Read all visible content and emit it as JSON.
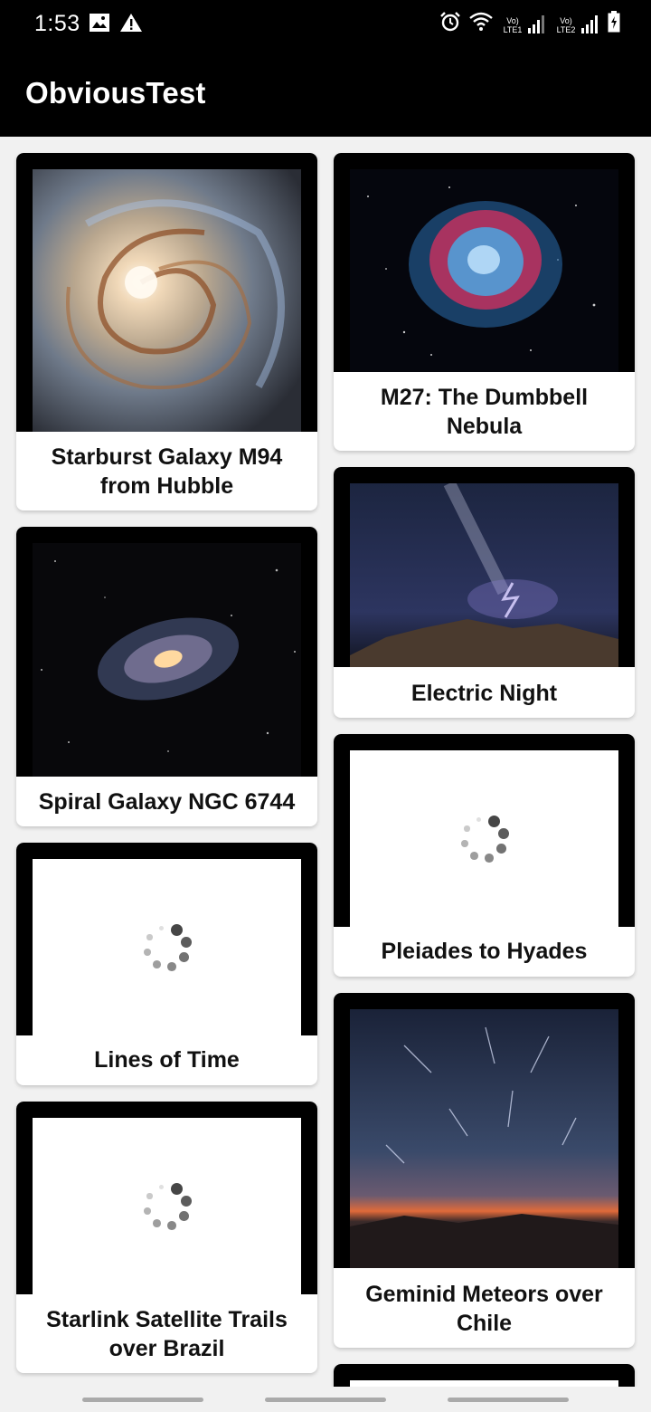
{
  "status_bar": {
    "time": "1:53",
    "left_icons": [
      "image-icon",
      "warning-icon"
    ],
    "right_icons": [
      "alarm-icon",
      "wifi-icon",
      "signal-lte1-icon",
      "signal-lte2-icon",
      "battery-charging-icon"
    ],
    "sim1_label": "Vo) LTE1",
    "sim2_label": "Vo) LTE2"
  },
  "app_bar": {
    "title": "ObviousTest"
  },
  "cards": [
    {
      "title": "Starburst Galaxy M94 from Hubble",
      "image": "galaxy-m94",
      "loading": false
    },
    {
      "title": "M27: The Dumbbell Nebula",
      "image": "dumbbell-nebula",
      "loading": false
    },
    {
      "title": "Spiral Galaxy NGC 6744",
      "image": "spiral-galaxy-ngc6744",
      "loading": false
    },
    {
      "title": "Electric Night",
      "image": "electric-night",
      "loading": false
    },
    {
      "title": "Lines of Time",
      "image": "loading-spinner",
      "loading": true
    },
    {
      "title": "Pleiades to Hyades",
      "image": "loading-spinner",
      "loading": true
    },
    {
      "title": "Starlink Satellite Trails over Brazil",
      "image": "loading-spinner",
      "loading": true
    },
    {
      "title": "Geminid Meteors over Chile",
      "image": "geminid-meteors",
      "loading": false
    }
  ],
  "colors": {
    "app_bar": "#000000",
    "background": "#f1f1f1",
    "card": "#ffffff",
    "text": "#111111"
  }
}
